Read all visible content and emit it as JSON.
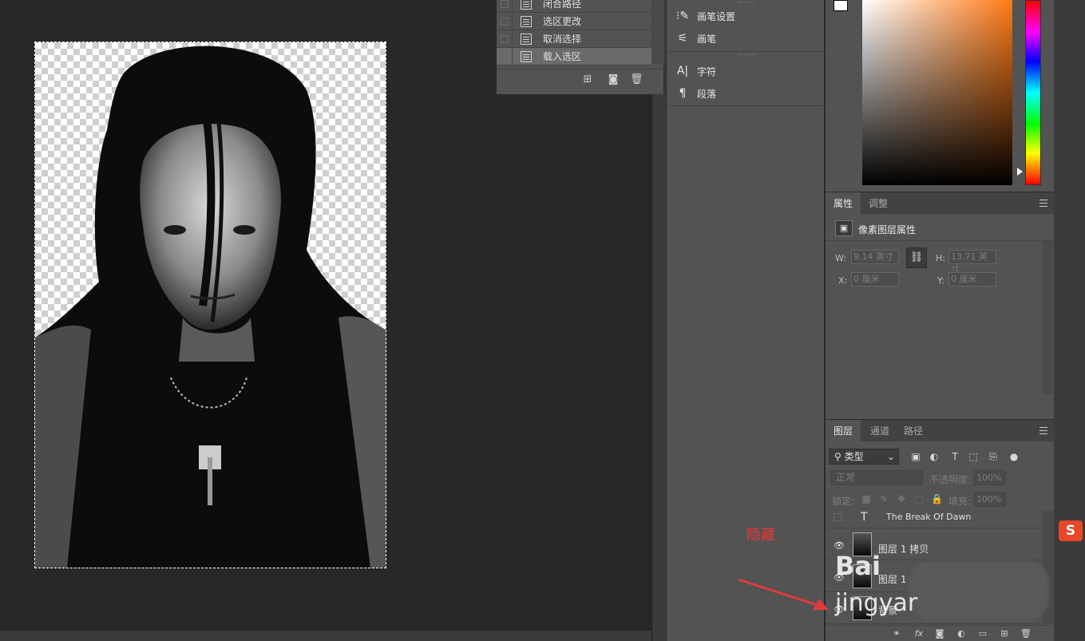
{
  "actions": {
    "items": [
      {
        "label": "闭合路径"
      },
      {
        "label": "选区更改"
      },
      {
        "label": "取消选择"
      },
      {
        "label": "载入选区"
      }
    ],
    "selected_index": 3,
    "footer_icons": [
      "new-action-icon",
      "camera-icon",
      "trash-icon"
    ]
  },
  "mid_panel": {
    "items": [
      {
        "label": "画笔设置",
        "icon": "brush-settings-icon"
      },
      {
        "label": "画笔",
        "icon": "brush-icon"
      },
      {
        "label": "字符",
        "icon": "character-icon"
      },
      {
        "label": "段落",
        "icon": "paragraph-icon"
      }
    ]
  },
  "color": {
    "foreground": "#ffffff",
    "background": "#000000",
    "hue_base": "#ff7a14"
  },
  "properties": {
    "tabs": [
      "属性",
      "调整"
    ],
    "active_tab": "属性",
    "title": "像素图层属性",
    "w_label": "W:",
    "w_value": "9.14 英寸",
    "h_label": "H:",
    "h_value": "13.71 英寸",
    "x_label": "X:",
    "x_value": "0 厘米",
    "y_label": "Y:",
    "y_value": "0 厘米"
  },
  "layers": {
    "tabs": [
      "图层",
      "通道",
      "路径"
    ],
    "active_tab": "图层",
    "filter_label": "类型",
    "blend_mode": "正常",
    "opacity_label": "不透明度:",
    "opacity_value": "100%",
    "lock_label": "锁定:",
    "fill_label": "填充:",
    "fill_value": "100%",
    "rows": [
      {
        "name": "The Break Of  Dawn",
        "type": "text",
        "visible": false
      },
      {
        "name": "图层 1 拷贝",
        "type": "pixel",
        "visible": true
      },
      {
        "name": "图层 1",
        "type": "pixel",
        "visible": true
      },
      {
        "name": "背景",
        "type": "pixel",
        "visible": true
      }
    ]
  },
  "annotation": {
    "text": "隐藏",
    "color": "#e23b3b"
  },
  "watermark": {
    "line1": "Bai",
    "line2": "jingyar"
  }
}
